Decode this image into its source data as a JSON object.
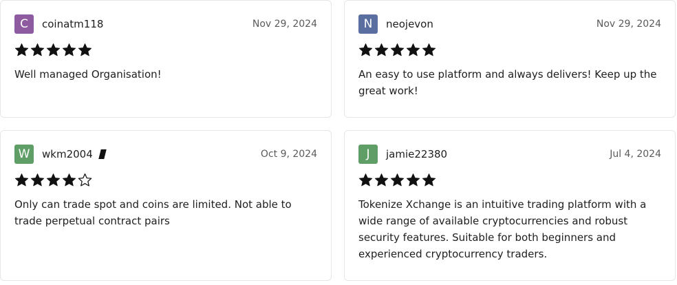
{
  "reviews": [
    {
      "avatar_letter": "C",
      "avatar_color": "#8e5aa0",
      "username": "coinatm118",
      "has_badge": false,
      "date": "Nov 29, 2024",
      "rating": 5,
      "text": "Well managed Organisation!"
    },
    {
      "avatar_letter": "N",
      "avatar_color": "#5a6ea0",
      "username": "neojevon",
      "has_badge": false,
      "date": "Nov 29, 2024",
      "rating": 5,
      "text": "An easy to use platform and always delivers! Keep up the great work!"
    },
    {
      "avatar_letter": "W",
      "avatar_color": "#5f9e66",
      "username": "wkm2004",
      "has_badge": true,
      "date": "Oct 9, 2024",
      "rating": 4,
      "text": "Only can trade spot and coins are limited. Not able to trade perpetual contract pairs"
    },
    {
      "avatar_letter": "J",
      "avatar_color": "#5f9e66",
      "username": "jamie22380",
      "has_badge": false,
      "date": "Jul 4, 2024",
      "rating": 5,
      "text": "Tokenize Xchange is an intuitive trading platform with a wide range of available cryptocurrencies and robust security features. Suitable for both beginners and experienced cryptocurrency traders."
    }
  ],
  "icons": {
    "star_filled": "star-filled-icon",
    "star_empty": "star-empty-icon",
    "badge": "verified-badge-icon"
  }
}
